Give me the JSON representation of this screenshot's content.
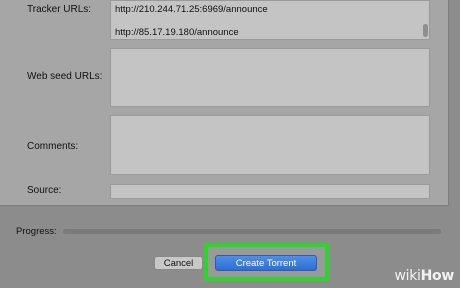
{
  "form": {
    "tracker_label": "Tracker URLs:",
    "tracker_urls": [
      "http://210.244.71.25:6969/announce",
      "http://85.17.19.180/announce"
    ],
    "web_seed_label": "Web seed URLs:",
    "web_seed_value": "",
    "comments_label": "Comments:",
    "comments_value": "",
    "source_label": "Source:",
    "source_value": ""
  },
  "progress": {
    "label": "Progress:",
    "value": 0
  },
  "buttons": {
    "cancel": "Cancel",
    "create": "Create Torrent"
  },
  "watermark": {
    "prefix": "wiki",
    "suffix": "How"
  }
}
